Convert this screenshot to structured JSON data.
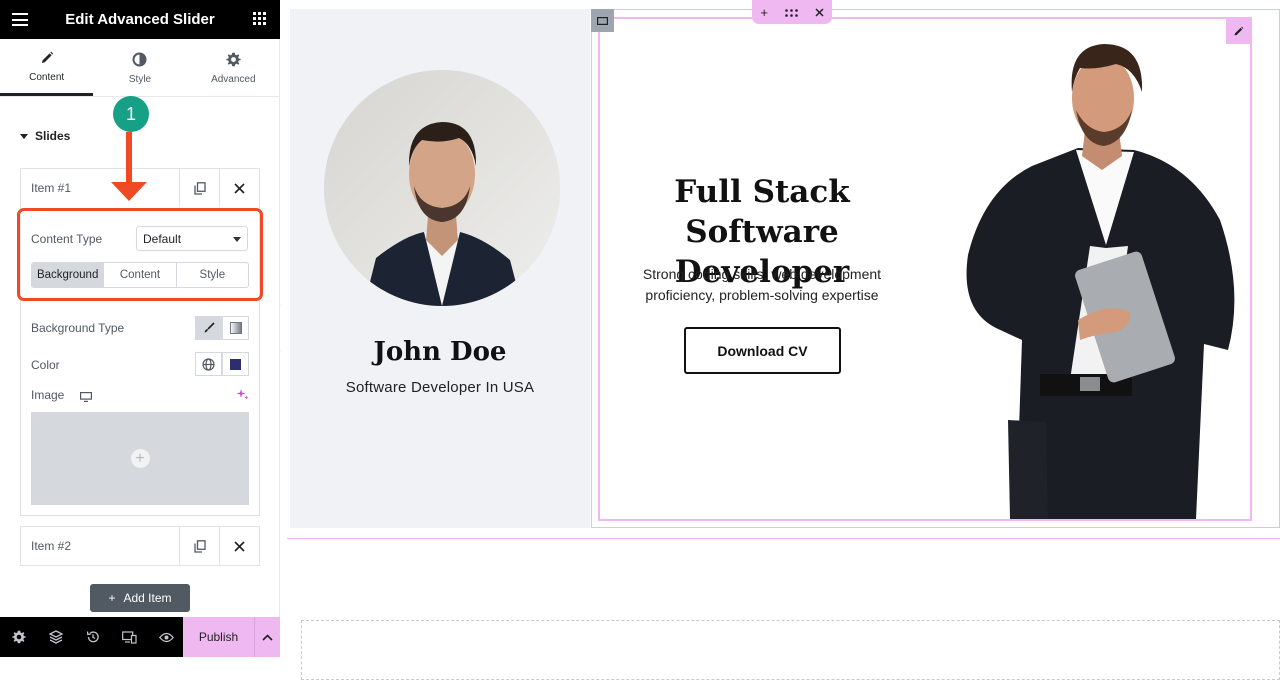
{
  "panel": {
    "title": "Edit Advanced Slider",
    "tabs": [
      {
        "label": "Content",
        "icon": "pencil-icon"
      },
      {
        "label": "Style",
        "icon": "half-circle-icon"
      },
      {
        "label": "Advanced",
        "icon": "gear-icon"
      }
    ],
    "section_title": "Slides",
    "items": [
      {
        "label": "Item #1"
      },
      {
        "label": "Item #2"
      }
    ],
    "controls": {
      "content_type_label": "Content Type",
      "content_type_value": "Default",
      "segments": [
        "Background",
        "Content",
        "Style"
      ],
      "background_type_label": "Background Type",
      "color_label": "Color",
      "image_label": "Image"
    },
    "add_item_label": "Add Item",
    "callout_number": "1",
    "footer": {
      "publish_label": "Publish"
    }
  },
  "preview": {
    "profile_name": "John Doe",
    "profile_role": "Software Developer In USA",
    "hero_title": "Full Stack Software Developer",
    "hero_text": "Strong coding skills, web development proficiency, problem-solving expertise",
    "cta_label": "Download CV"
  },
  "colors": {
    "accent_pink": "#f0b8f1",
    "callout_red": "#ef4a25",
    "badge_teal": "#16a085",
    "header_black": "#000000",
    "color_swatch": "#2c2e6e"
  }
}
